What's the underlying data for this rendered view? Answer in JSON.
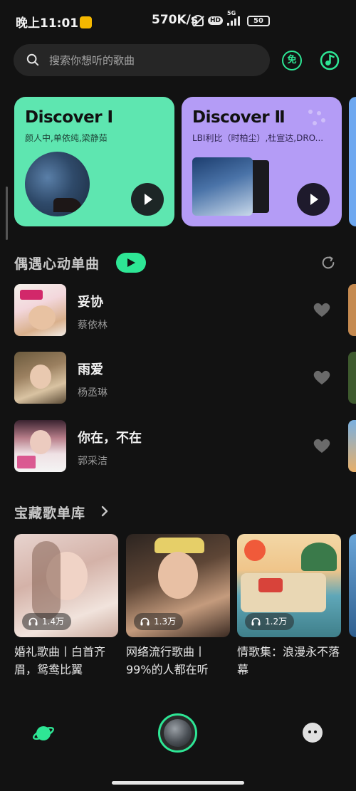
{
  "status_bar": {
    "time": "晚上11:01",
    "net_speed": "570K/s",
    "hd_label": "HD",
    "network_label": "5G",
    "battery": "50"
  },
  "search": {
    "placeholder": "搜索你想听的歌曲",
    "free_label": "免"
  },
  "discover": [
    {
      "title": "Discover Ⅰ",
      "artists": "颜人中,单依纯,梁静茹",
      "bg_color": "#5ee6b0"
    },
    {
      "title": "Discover Ⅱ",
      "artists": "LBI利比（时柏尘）,杜宣达,DRO...",
      "bg_color": "#b49cf6"
    }
  ],
  "daily_songs": {
    "title": "偶遇心动单曲",
    "songs": [
      {
        "title": "妥协",
        "artist": "蔡依林"
      },
      {
        "title": "雨爱",
        "artist": "杨丞琳"
      },
      {
        "title": "你在，不在",
        "artist": "郭采洁"
      }
    ]
  },
  "playlists": {
    "title": "宝藏歌单库",
    "items": [
      {
        "name": "婚礼歌曲丨白首齐眉，鸳鸯比翼",
        "play_count": "1.4万"
      },
      {
        "name": "网络流行歌曲丨99%的人都在听",
        "play_count": "1.3万"
      },
      {
        "name": "情歌集：浪漫永不落幕",
        "play_count": "1.2万"
      }
    ]
  },
  "theme": {
    "accent": "#2ee695",
    "background": "#121212"
  },
  "icons": {
    "search": "search-icon",
    "music": "music-note-icon",
    "refresh": "refresh-icon",
    "heart": "heart-icon",
    "chevron": "chevron-right-icon",
    "headphones": "headphones-icon",
    "planet": "planet-icon",
    "profile": "face-icon"
  }
}
